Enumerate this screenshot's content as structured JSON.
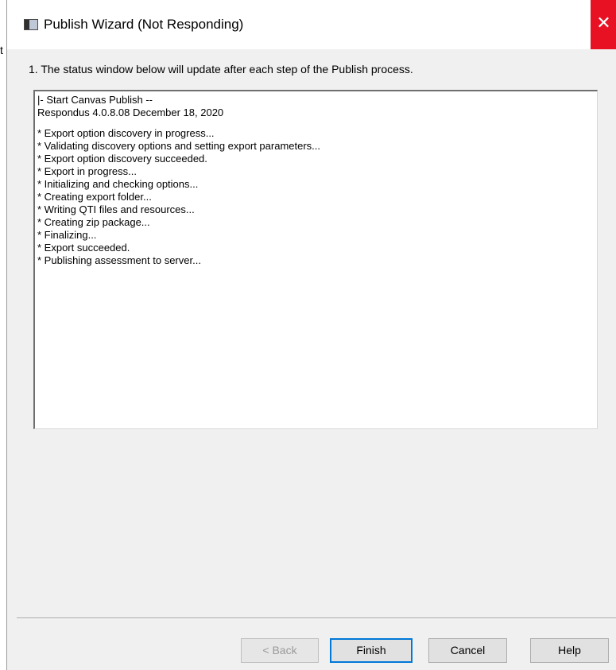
{
  "window": {
    "title": "Publish Wizard (Not Responding)",
    "close_label": "✕",
    "stray_text": "t"
  },
  "instruction": "1.  The status window below will update after each step of the Publish process.",
  "status": {
    "header_lines": [
      "|- Start Canvas Publish --",
      "Respondus 4.0.8.08  December 18, 2020"
    ],
    "steps": [
      "* Export option discovery in progress...",
      "* Validating discovery options and setting export parameters...",
      "* Export option discovery succeeded.",
      "* Export in progress...",
      "* Initializing and checking options...",
      "* Creating export folder...",
      "* Writing QTI files and resources...",
      "* Creating zip package...",
      "* Finalizing...",
      "* Export succeeded.",
      "* Publishing assessment to server..."
    ]
  },
  "buttons": {
    "back": "< Back",
    "finish": "Finish",
    "cancel": "Cancel",
    "help": "Help"
  },
  "colors": {
    "close_red": "#e81123",
    "focus_blue": "#0078d7"
  }
}
